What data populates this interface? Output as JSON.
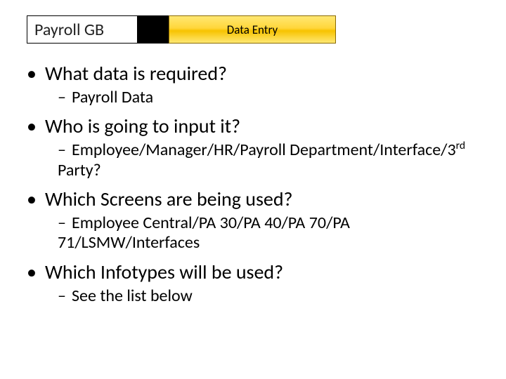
{
  "title": {
    "left": "Payroll GB",
    "right": "Data Entry"
  },
  "bullets": [
    {
      "text": "What data is required?",
      "sub": [
        {
          "text": "Payroll Data"
        }
      ]
    },
    {
      "text": "Who is going to input it?",
      "sub": [
        {
          "html": "Employee/Manager/HR/Payroll Department/Interface/3<sup>rd</sup> Party?"
        }
      ]
    },
    {
      "text": "Which Screens are being used?",
      "sub": [
        {
          "text": "Employee Central/PA 30/PA 40/PA 70/PA 71/LSMW/Interfaces"
        }
      ]
    },
    {
      "text": "Which Infotypes will be used?",
      "sub": [
        {
          "text": "See the list below"
        }
      ]
    }
  ]
}
